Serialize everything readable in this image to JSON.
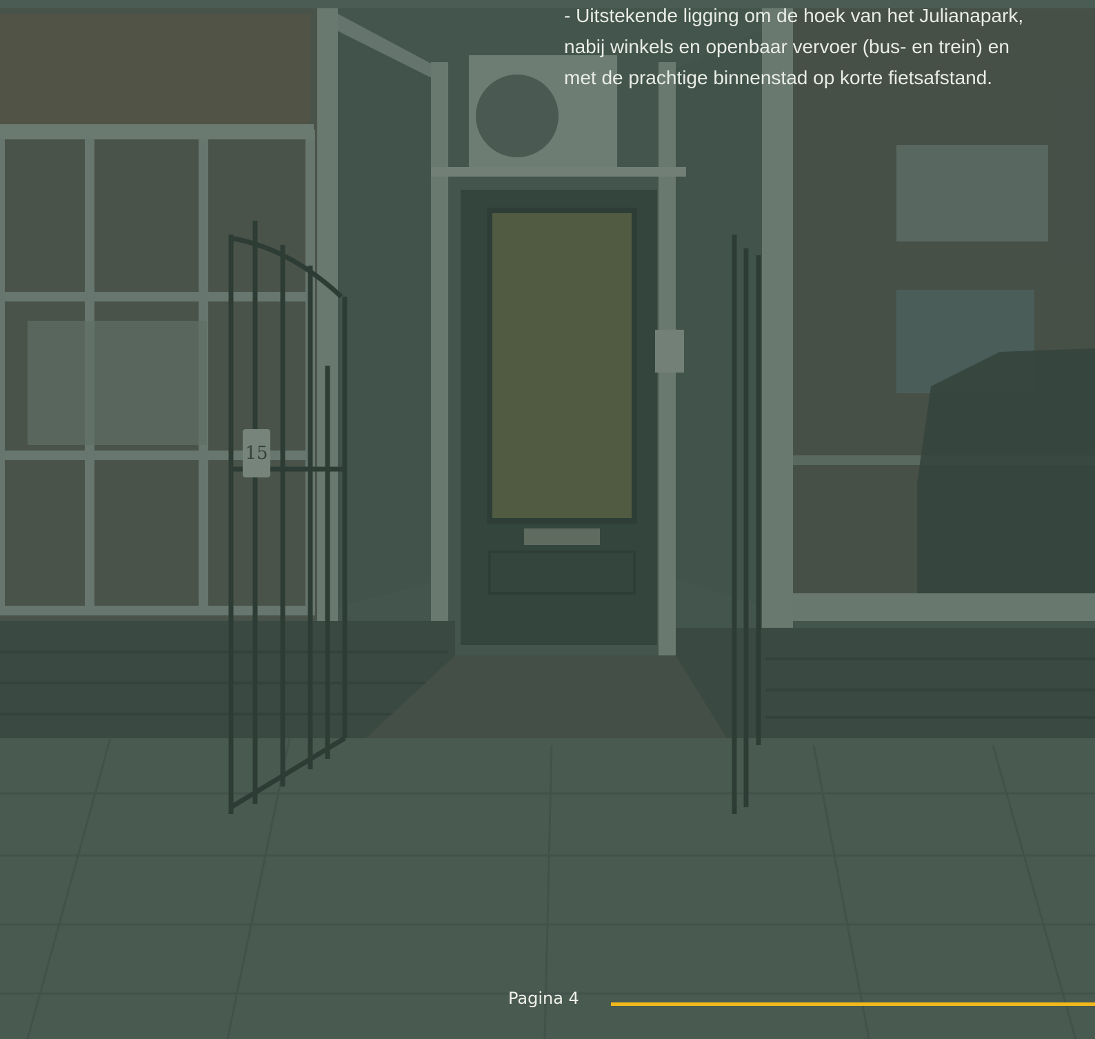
{
  "intro": {
    "text": "- Uitstekende ligging om de hoek van het Julianapark, nabij winkels en openbaar vervoer (bus- en trein) en met de prachtige binnenstad op korte fietsafstand."
  },
  "footer": {
    "page_label": "Pagina 4",
    "accent_color": "#f2b81c"
  },
  "photo": {
    "house_number": "15"
  }
}
